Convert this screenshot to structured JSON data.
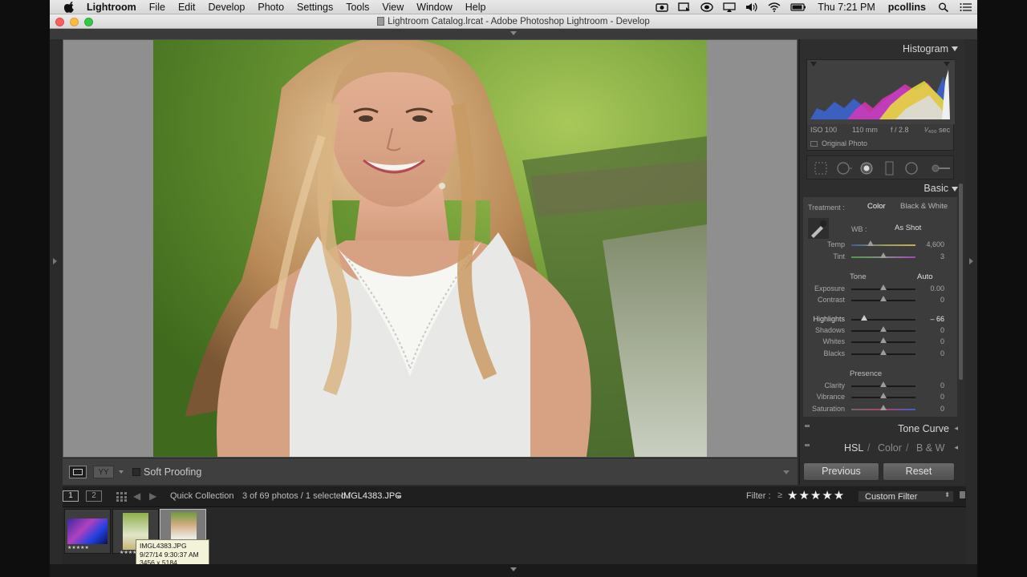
{
  "menubar": {
    "app_name": "Lightroom",
    "items": [
      "File",
      "Edit",
      "Develop",
      "Photo",
      "Settings",
      "Tools",
      "View",
      "Window",
      "Help"
    ],
    "clock": "Thu 7:21 PM",
    "user": "pcollins"
  },
  "window": {
    "title": "Lightroom Catalog.lrcat - Adobe Photoshop Lightroom - Develop"
  },
  "histogram": {
    "header": "Histogram",
    "iso": "ISO 100",
    "focal": "110 mm",
    "aperture": "f / 2.8",
    "shutter": "¹⁄₄₀₀ sec",
    "original_label": "Original Photo"
  },
  "basic": {
    "header": "Basic",
    "treatment_label": "Treatment :",
    "treatment_color": "Color",
    "treatment_bw": "Black & White",
    "wb_label": "WB :",
    "wb_value": "As Shot",
    "temp": {
      "label": "Temp",
      "value": "4,600",
      "level": 0.3
    },
    "tint": {
      "label": "Tint",
      "value": "3",
      "level": 0.5
    },
    "tone_label": "Tone",
    "auto_label": "Auto",
    "exposure": {
      "label": "Exposure",
      "value": "0.00",
      "level": 0.5
    },
    "contrast": {
      "label": "Contrast",
      "value": "0",
      "level": 0.5
    },
    "highlights": {
      "label": "Highlights",
      "value": "– 66",
      "level": 0.2
    },
    "shadows": {
      "label": "Shadows",
      "value": "0",
      "level": 0.5
    },
    "whites": {
      "label": "Whites",
      "value": "0",
      "level": 0.5
    },
    "blacks": {
      "label": "Blacks",
      "value": "0",
      "level": 0.5
    },
    "presence_label": "Presence",
    "clarity": {
      "label": "Clarity",
      "value": "0",
      "level": 0.5
    },
    "vibrance": {
      "label": "Vibrance",
      "value": "0",
      "level": 0.5
    },
    "saturation": {
      "label": "Saturation",
      "value": "0",
      "level": 0.5
    }
  },
  "panels": {
    "tone_curve": "Tone Curve",
    "hsl": "HSL",
    "sep1": "/",
    "color": "Color",
    "sep2": "/",
    "bw": "B & W"
  },
  "buttons": {
    "previous": "Previous",
    "reset": "Reset"
  },
  "toolbar": {
    "soft_proofing": "Soft Proofing"
  },
  "filmstrip_bar": {
    "page1": "1",
    "page2": "2",
    "source": "Quick Collection",
    "count": "3 of 69 photos / 1 selected /",
    "filename": "IMGL4383.JPG",
    "filter_label": "Filter :",
    "filter_op": "≥",
    "stars": "★★★★★",
    "custom_filter": "Custom Filter"
  },
  "thumbnails": [
    {
      "stars": "★★★★★"
    },
    {
      "stars": "★★★★"
    },
    {
      "stars": ""
    }
  ],
  "tooltip": {
    "line1": "IMGL4383.JPG",
    "line2": "9/27/14 9:30:37 AM",
    "line3": "3456 x 5184"
  },
  "colors": {
    "panel_bg": "#2e2e2e",
    "image_bg": "#8f8f8f"
  }
}
